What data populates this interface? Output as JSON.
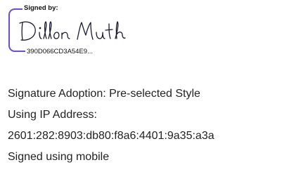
{
  "signature": {
    "label": "Signed by:",
    "name": "Dillon Muth",
    "id": "390D066CD3A54E9...",
    "accent_color": "#6a4fd0"
  },
  "details": {
    "adoption": "Signature Adoption: Pre-selected Style",
    "ip_label": "Using IP Address:",
    "ip_address": "2601:282:8903:db80:f8a6:4401:9a35:a3a",
    "method": "Signed using mobile"
  }
}
